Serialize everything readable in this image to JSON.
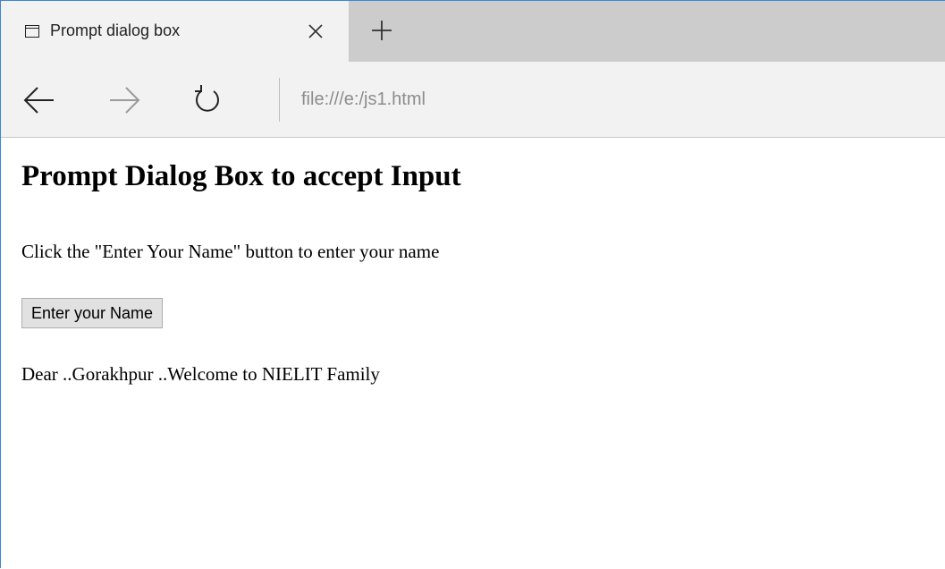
{
  "browser": {
    "tab": {
      "title": "Prompt dialog box",
      "page_icon": "page-icon",
      "close_icon": "close-icon"
    },
    "new_tab_icon": "plus-icon",
    "nav": {
      "back_icon": "back-arrow-icon",
      "forward_icon": "forward-arrow-icon",
      "refresh_icon": "refresh-icon"
    },
    "address": "file:///e:/js1.html",
    "colors": {
      "tabstrip": "#cccccc",
      "active_tab": "#f2f2f2",
      "address_text": "#8c8c8c"
    }
  },
  "page": {
    "heading": "Prompt Dialog Box to accept Input",
    "description": "Click the \"Enter Your Name\" button to enter your name",
    "button_label": "Enter your Name",
    "result": "Dear ..Gorakhpur ..Welcome to NIELIT Family"
  }
}
